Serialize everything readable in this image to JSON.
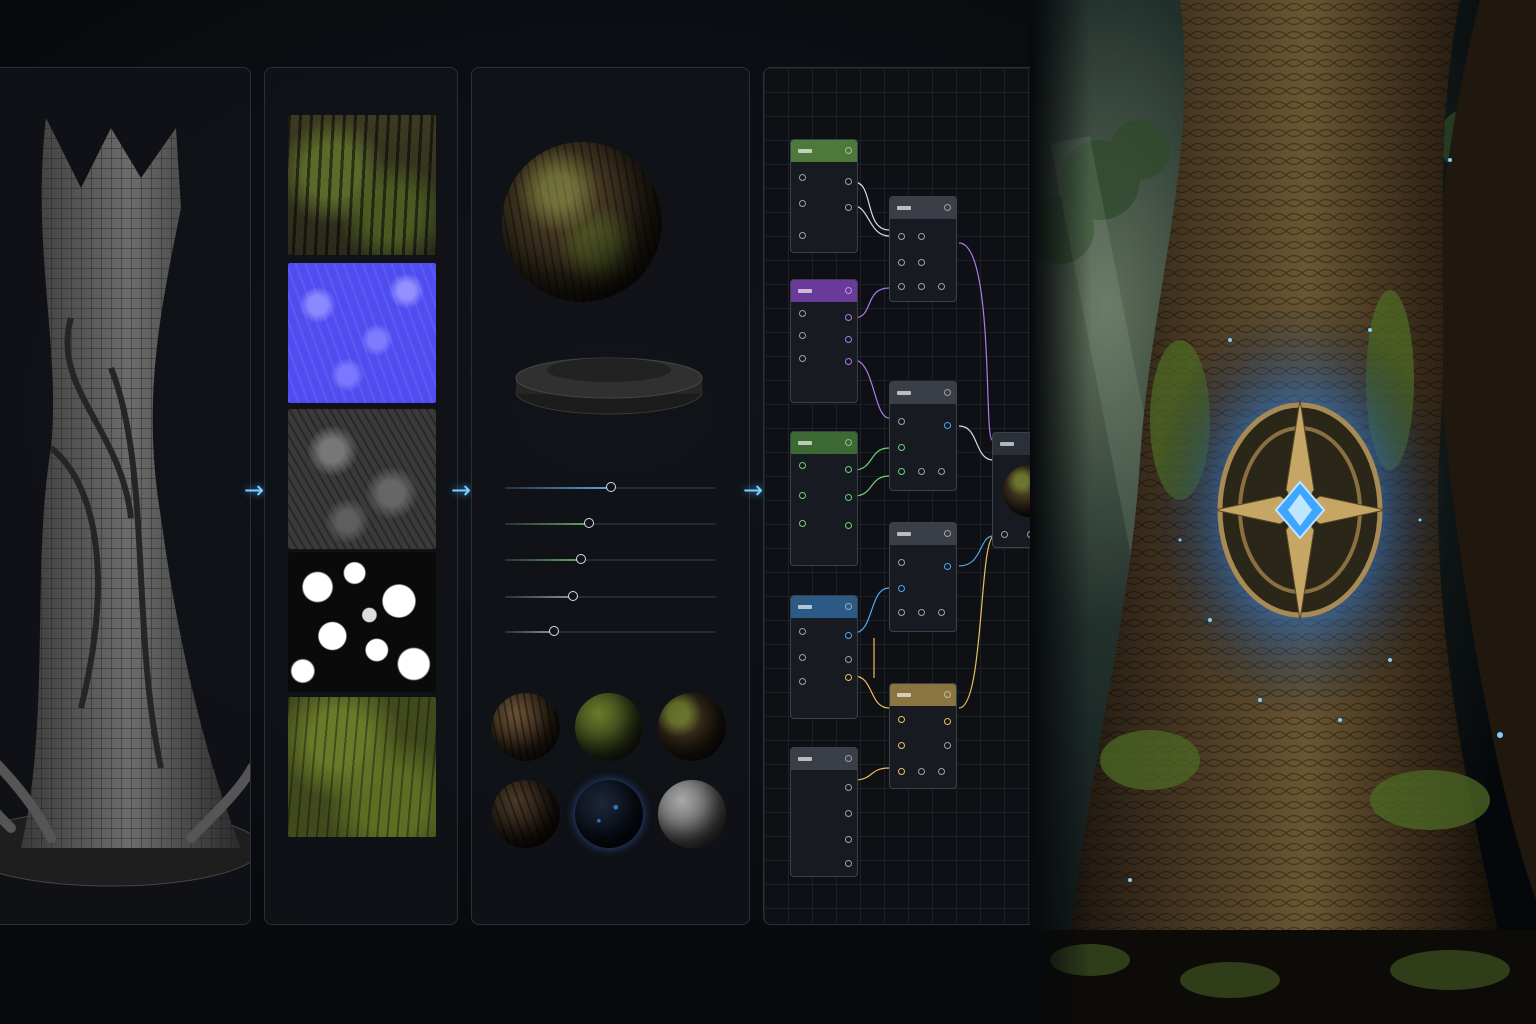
{
  "pipeline": {
    "stages": [
      "mesh",
      "texture-maps",
      "material",
      "node-graph",
      "final-render"
    ]
  },
  "material_panel": {
    "sliders": [
      {
        "value": 0.5,
        "color": "#4ea8e8"
      },
      {
        "value": 0.4,
        "color": "#5fa860"
      },
      {
        "value": 0.36,
        "color": "#5fa860"
      },
      {
        "value": 0.32,
        "color": "#8a9099"
      },
      {
        "value": 0.23,
        "color": "#8a9099"
      }
    ],
    "presets": [
      "bark",
      "moss",
      "mossy-bark",
      "dark-bark",
      "glowing",
      "stone"
    ]
  },
  "node_graph": {
    "wire_colors": [
      "#d8dde4",
      "#b07ae8",
      "#6fd07a",
      "#4fa8e8",
      "#e8c25a"
    ],
    "header_colors": [
      "#4d7a3a",
      "#6a3a9a",
      "#3d6a34",
      "#2c5a86",
      "#3a3f47",
      "#8a7440"
    ]
  },
  "colors": {
    "accent": "#3aa0ff",
    "background": "#07090c"
  }
}
